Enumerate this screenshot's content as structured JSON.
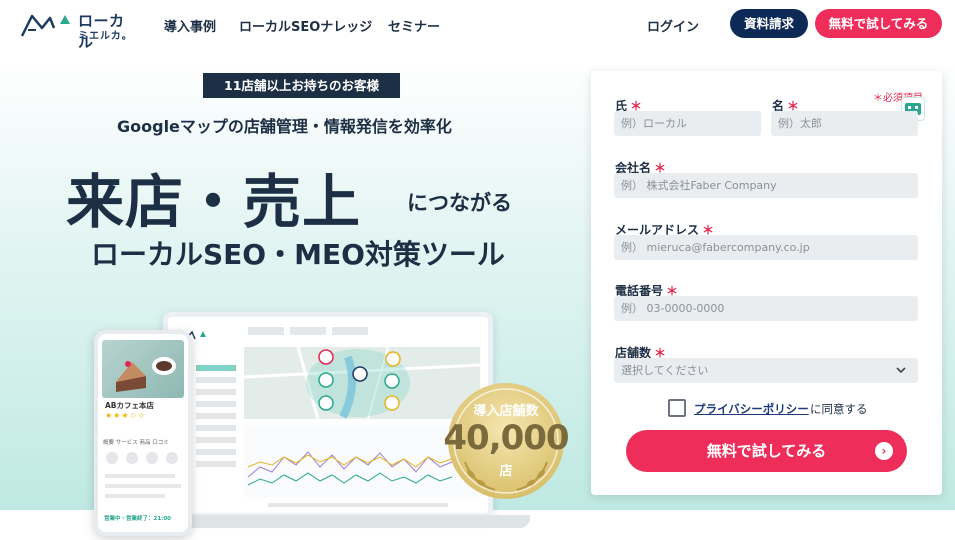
{
  "header": {
    "logo_main": "ローカル",
    "logo_sub": "ミエルカ。",
    "nav": [
      {
        "label": "導入事例"
      },
      {
        "label": "ローカルSEOナレッジ"
      },
      {
        "label": "セミナー"
      }
    ],
    "login": "ログイン",
    "docs_button": "資料請求",
    "trial_button": "無料で試してみる"
  },
  "hero": {
    "tag": "11店舗以上お持ちのお客様",
    "subheadline": "Googleマップの店舗管理・情報発信を効率化",
    "headline_main": "来店・売上",
    "headline_suffix": "につながる",
    "headline_product": "ローカルSEO・MEO対策ツール",
    "phone": {
      "shop_name": "ABカフェ本店",
      "stars": "★★★☆☆",
      "tabs": "概要  サービス  商品  口コミ",
      "status": "営業中・営業終了：21:00"
    },
    "badge": {
      "title": "導入店舗数",
      "number": "40,000",
      "unit": "店"
    }
  },
  "form": {
    "required_note": "＊必須項目",
    "fields": {
      "last_name": {
        "label": "氏",
        "placeholder": "例）ローカル"
      },
      "first_name": {
        "label": "名",
        "placeholder": "例）太郎"
      },
      "company": {
        "label": "会社名",
        "placeholder": "例） 株式会社Faber Company"
      },
      "email": {
        "label": "メールアドレス",
        "placeholder": "例） mieruca@fabercompany.co.jp"
      },
      "phone": {
        "label": "電話番号",
        "placeholder": "例） 03-0000-0000"
      },
      "stores": {
        "label": "店舗数",
        "value": "選択してください"
      }
    },
    "required_mark": "＊",
    "policy_link": "プライバシーポリシー",
    "policy_text": "に同意する",
    "submit": "無料で試してみる",
    "submit_arrow": "›"
  },
  "colors": {
    "navy": "#1d2f45",
    "accent_pink": "#ee2d5b",
    "docs_blue": "#0d2a57",
    "teal_light": "#bfe9e3"
  }
}
